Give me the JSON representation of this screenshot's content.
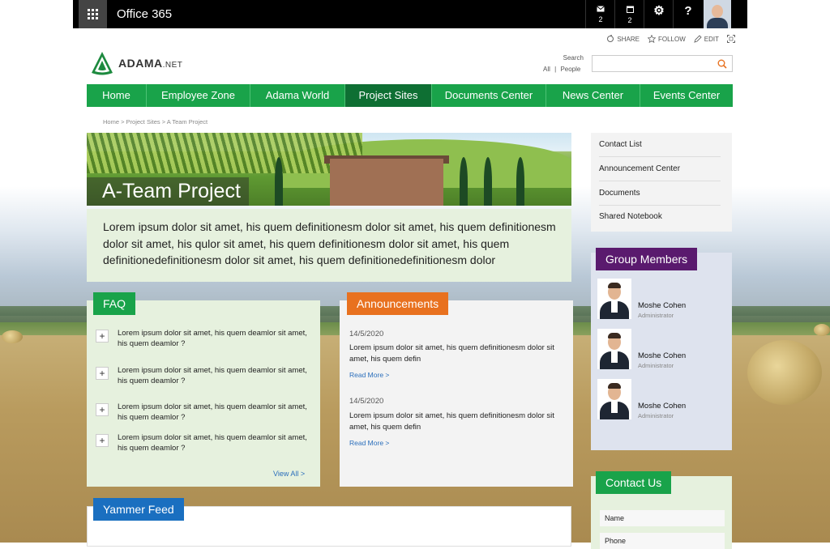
{
  "topbar": {
    "title": "Office 365",
    "mail_count": "2",
    "calendar_count": "2",
    "settings_glyph": "⚙",
    "help_glyph": "?"
  },
  "actions": {
    "share": "SHARE",
    "follow": "FOLLOW",
    "edit": "EDIT"
  },
  "logo": {
    "name": "ADAMA",
    "suffix": ".NET"
  },
  "search": {
    "label": "Search",
    "scope_all": "All",
    "scope_sep": "|",
    "scope_people": "People",
    "placeholder": ""
  },
  "nav": [
    {
      "label": "Home",
      "active": false
    },
    {
      "label": "Employee Zone",
      "active": false
    },
    {
      "label": "Adama World",
      "active": false
    },
    {
      "label": "Project Sites",
      "active": true
    },
    {
      "label": "Documents Center",
      "active": false
    },
    {
      "label": "News Center",
      "active": false
    },
    {
      "label": "Events Center",
      "active": false
    }
  ],
  "breadcrumb": "Home > Project Sites > A Team Project",
  "banner": {
    "title": "A-Team Project"
  },
  "intro": "Lorem ipsum dolor sit amet, his quem definitionesm dolor sit amet, his quem definitionesm dolor sit amet, his qulor sit amet, his quem definitionesm dolor sit amet, his quem definitionedefinitionesm dolor sit amet, his quem definitionedefinitionesm dolor",
  "faq": {
    "label": "FAQ",
    "plus": "+",
    "items": [
      "Lorem ipsum dolor sit amet, his quem deamlor sit amet, his quem deamlor ?",
      "Lorem ipsum dolor sit amet, his quem deamlor sit amet, his quem deamlor ?",
      "Lorem ipsum dolor sit amet, his quem deamlor sit amet, his quem deamlor ?",
      "Lorem ipsum dolor sit amet, his quem deamlor sit amet, his quem deamlor ?"
    ],
    "view_all": "View All  >"
  },
  "announcements": {
    "label": "Announcements",
    "items": [
      {
        "date": "14/5/2020",
        "text": "Lorem ipsum dolor sit amet, his quem definitionesm dolor sit amet, his quem defin",
        "more": "Read More >"
      },
      {
        "date": "14/5/2020",
        "text": "Lorem ipsum dolor sit amet, his quem definitionesm dolor sit amet, his quem defin",
        "more": "Read More >"
      }
    ]
  },
  "yammer": {
    "label": "Yammer Feed"
  },
  "quick_links": [
    "Contact List",
    "Announcement Center",
    "Documents",
    "Shared Notebook"
  ],
  "members": {
    "label": "Group Members",
    "items": [
      {
        "name": "Moshe Cohen",
        "role": "Administrator"
      },
      {
        "name": "Moshe Cohen",
        "role": "Administrator"
      },
      {
        "name": "Moshe Cohen",
        "role": "Administrator"
      }
    ]
  },
  "contact": {
    "label": "Contact Us",
    "fields": [
      "Name",
      "Phone"
    ]
  },
  "colors": {
    "nav_green": "#19a34a",
    "nav_active": "#0e6f33",
    "faq_green": "#19a34a",
    "announcement_orange": "#e8711f",
    "yammer_blue": "#1a6fc0",
    "members_purple": "#5a1a6e",
    "contact_green": "#19a34a",
    "link_blue": "#2a6ebb"
  }
}
